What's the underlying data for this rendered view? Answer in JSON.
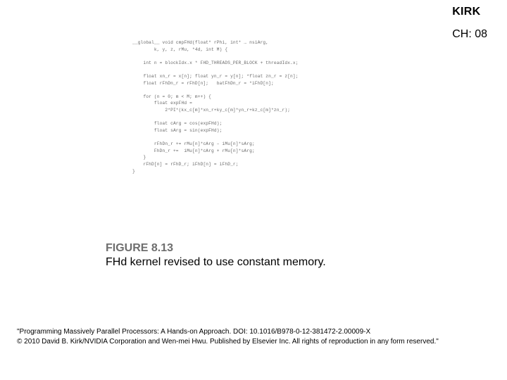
{
  "header": {
    "book_abbr": "KIRK",
    "chapter": "CH: 08"
  },
  "code": "__global__ void cmpFHd(float* rPhi, int* … nsiArg,\n        k, y, z, rMu, *4d, int M) {\n\n    int n = blockIdx.x * FHD_THREADS_PER_BLOCK + threadIdx.x;\n\n    float xn_r = x[n]; float yn_r = y[n]; *float zn_r = z[n];\n    float rFhDn_r = rFhD[n];   batFhDn_r = *iFhD[n];\n\n    for (n = 0; m < M; m++) {\n        float expFHd =\n            2*PI*(kx_c[m]*xn_r+ky_c[m]*yn_r+kz_c[m]*zn_r);\n\n        float cArg = cos(expFHd);\n        float sArg = sin(expFHd);\n\n        rFhDn_r += rMu[n]*cArg – iMu[n]*sArg;\n        FhDn_r +=  iMu[n]*cArg + rMu[n]*sArg;\n    }\n    rFhD[n] = rFhD_r; iFhD[n] = iFhD_r;\n}",
  "figure": {
    "label": "FIGURE 8.13",
    "caption": "FHd kernel revised to use constant memory."
  },
  "footer": {
    "line1": "\"Programming Massively Parallel Processors: A Hands-on Approach. DOI: 10.1016/B978-0-12-381472-2.00009-X",
    "line2": "© 2010 David B. Kirk/NVIDIA Corporation and Wen-mei Hwu. Published by Elsevier Inc. All rights of reproduction in any form reserved.\""
  }
}
